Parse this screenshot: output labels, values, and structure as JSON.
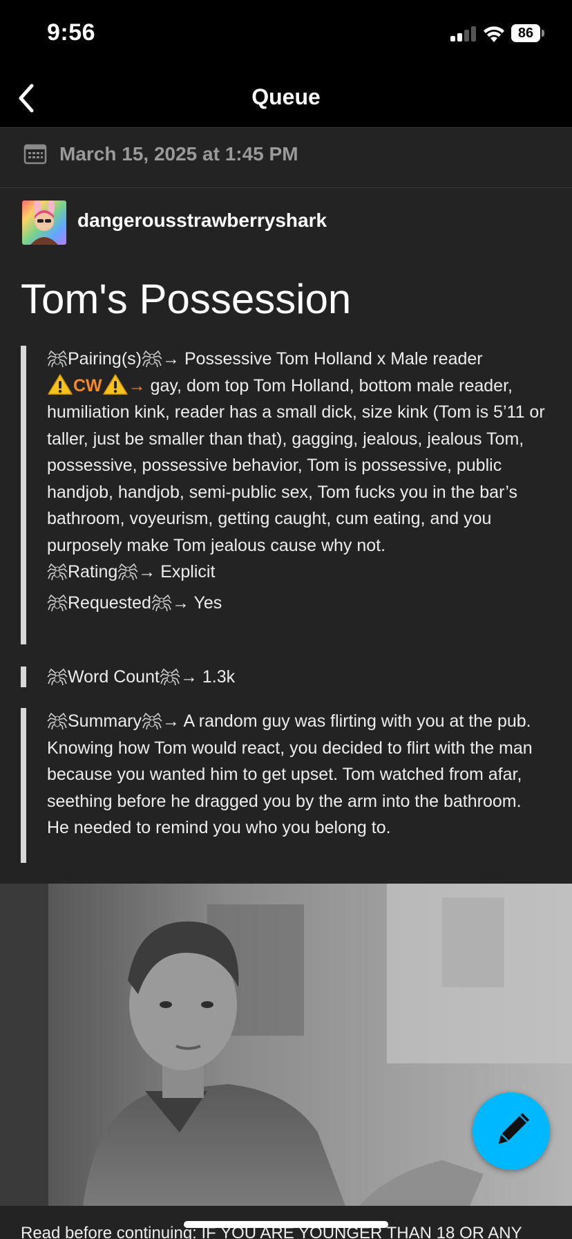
{
  "status_bar": {
    "time": "9:56",
    "battery": "86",
    "icons": [
      "cellular-signal-icon",
      "wifi-icon",
      "battery-icon"
    ]
  },
  "nav": {
    "title": "Queue",
    "back_icon": "chevron-left-icon"
  },
  "schedule": {
    "icon": "calendar-icon",
    "text": "March 15, 2025 at 1:45 PM"
  },
  "post": {
    "author": "dangerousstrawberryshark",
    "title": "Tom's Possession",
    "pairing_label": "Pairing(s)",
    "pairing_value": "Possessive Tom Holland x Male reader",
    "cw_label": "CW",
    "cw_text": "gay, dom top Tom Holland, bottom male reader, humiliation kink, reader has a small dick, size kink (Tom is 5’11 or taller, just be smaller than that), gagging, jealous, jealous Tom, possessive, possessive behavior, Tom is possessive, public handjob, handjob, semi-public sex, Tom fucks you in the bar’s bathroom, voyeurism, getting caught, cum eating, and you purposely make Tom jealous cause why not.",
    "rating_label": "Rating",
    "rating_value": "Explicit",
    "requested_label": "Requested",
    "requested_value": "Yes",
    "wordcount_label": "Word Count",
    "wordcount_value": "1.3k",
    "summary_label": "Summary",
    "summary_text": "A random guy was flirting with you at the pub. Knowing how Tom would react, you decided to flirt with the man because you wanted him to get upset. Tom watched from afar, seething before he dragged you by the arm into the bathroom. He needed to remind you who you belong to.",
    "arrow": "→"
  },
  "fab": {
    "icon": "pencil-icon"
  },
  "footer": {
    "text": "Read before continuing: IF YOU ARE YOUNGER THAN 18 OR ANY"
  },
  "colors": {
    "accent": "#00b8ff",
    "cw": "#f08a2a",
    "background": "#232323"
  }
}
